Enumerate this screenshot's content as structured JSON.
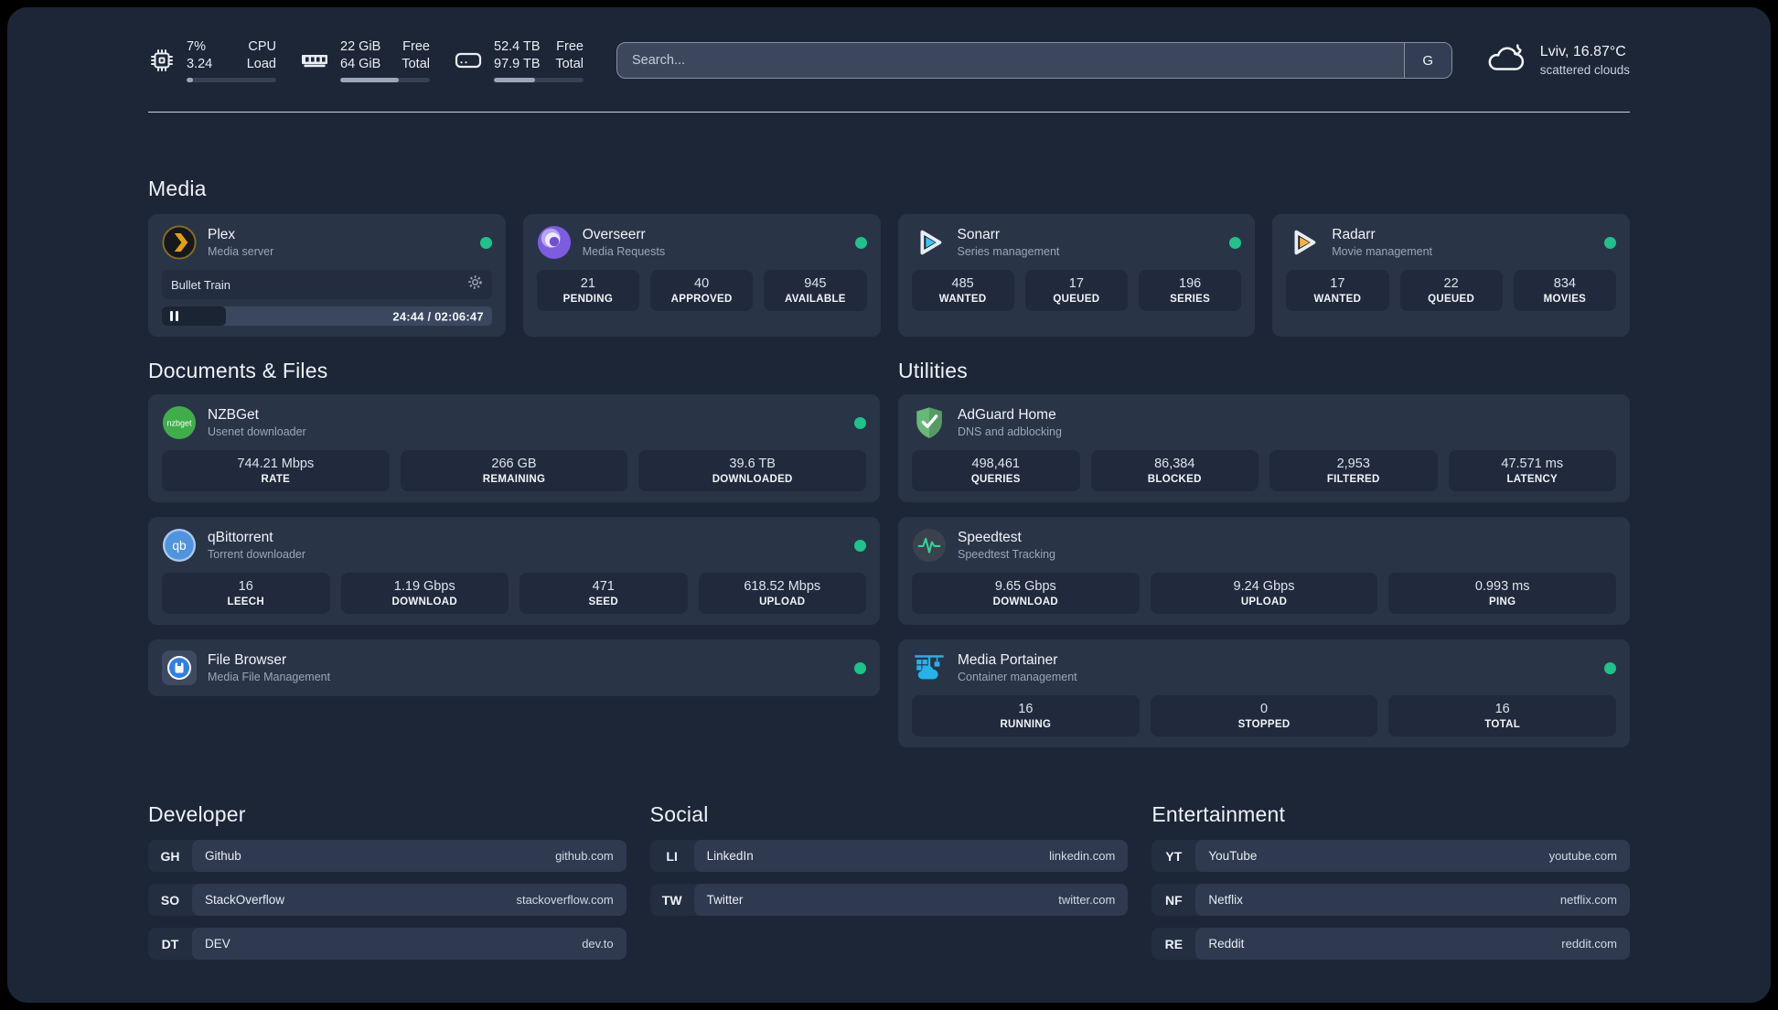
{
  "colors": {
    "status": "#1ec28b",
    "plex": "#e5a00d",
    "overseerr": "#8a6df0",
    "sonarr": "#35c5f4",
    "radarr": "#f7b13c",
    "nzbget": "#3fae4a",
    "qbittorrent": "#4f94dd",
    "filebrowser": "#2f7fe8",
    "adguard": "#67b879",
    "speedtest": "#2fd49c",
    "portainer": "#25b3e8"
  },
  "header": {
    "stats": [
      {
        "id": "cpu",
        "values": [
          "7%",
          "3.24"
        ],
        "labels": [
          "CPU",
          "Load"
        ],
        "progress_pct": 7
      },
      {
        "id": "memory",
        "values": [
          "22 GiB",
          "64 GiB"
        ],
        "labels": [
          "Free",
          "Total"
        ],
        "progress_pct": 65
      },
      {
        "id": "storage",
        "values": [
          "52.4 TB",
          "97.9 TB"
        ],
        "labels": [
          "Free",
          "Total"
        ],
        "progress_pct": 46
      }
    ],
    "search": {
      "placeholder": "Search...",
      "provider_button": "G"
    },
    "weather": {
      "location_temp": "Lviv, 16.87°C",
      "condition": "scattered clouds"
    }
  },
  "media": {
    "title": "Media",
    "plex": {
      "title": "Plex",
      "subtitle": "Media server",
      "now_playing": {
        "title": "Bullet Train",
        "time": "24:44 / 02:06:47",
        "progress_pct": 19.5
      }
    },
    "overseerr": {
      "title": "Overseerr",
      "subtitle": "Media Requests",
      "stats": [
        {
          "value": "21",
          "label": "PENDING"
        },
        {
          "value": "40",
          "label": "APPROVED"
        },
        {
          "value": "945",
          "label": "AVAILABLE"
        }
      ]
    },
    "sonarr": {
      "title": "Sonarr",
      "subtitle": "Series management",
      "stats": [
        {
          "value": "485",
          "label": "WANTED"
        },
        {
          "value": "17",
          "label": "QUEUED"
        },
        {
          "value": "196",
          "label": "SERIES"
        }
      ]
    },
    "radarr": {
      "title": "Radarr",
      "subtitle": "Movie management",
      "stats": [
        {
          "value": "17",
          "label": "WANTED"
        },
        {
          "value": "22",
          "label": "QUEUED"
        },
        {
          "value": "834",
          "label": "MOVIES"
        }
      ]
    }
  },
  "documents": {
    "title": "Documents & Files",
    "nzbget": {
      "title": "NZBGet",
      "subtitle": "Usenet downloader",
      "stats": [
        {
          "value": "744.21 Mbps",
          "label": "RATE"
        },
        {
          "value": "266 GB",
          "label": "REMAINING"
        },
        {
          "value": "39.6 TB",
          "label": "DOWNLOADED"
        }
      ]
    },
    "qbittorrent": {
      "title": "qBittorrent",
      "subtitle": "Torrent downloader",
      "stats": [
        {
          "value": "16",
          "label": "LEECH"
        },
        {
          "value": "1.19 Gbps",
          "label": "DOWNLOAD"
        },
        {
          "value": "471",
          "label": "SEED"
        },
        {
          "value": "618.52 Mbps",
          "label": "UPLOAD"
        }
      ]
    },
    "filebrowser": {
      "title": "File Browser",
      "subtitle": "Media File Management"
    }
  },
  "utilities": {
    "title": "Utilities",
    "adguard": {
      "title": "AdGuard Home",
      "subtitle": "DNS and adblocking",
      "stats": [
        {
          "value": "498,461",
          "label": "QUERIES"
        },
        {
          "value": "86,384",
          "label": "BLOCKED"
        },
        {
          "value": "2,953",
          "label": "FILTERED"
        },
        {
          "value": "47.571 ms",
          "label": "LATENCY"
        }
      ]
    },
    "speedtest": {
      "title": "Speedtest",
      "subtitle": "Speedtest Tracking",
      "stats": [
        {
          "value": "9.65 Gbps",
          "label": "DOWNLOAD"
        },
        {
          "value": "9.24 Gbps",
          "label": "UPLOAD"
        },
        {
          "value": "0.993 ms",
          "label": "PING"
        }
      ]
    },
    "portainer": {
      "title": "Media Portainer",
      "subtitle": "Container management",
      "stats": [
        {
          "value": "16",
          "label": "RUNNING"
        },
        {
          "value": "0",
          "label": "STOPPED"
        },
        {
          "value": "16",
          "label": "TOTAL"
        }
      ]
    }
  },
  "links": {
    "developer": {
      "title": "Developer",
      "items": [
        {
          "abbr": "GH",
          "name": "Github",
          "url": "github.com"
        },
        {
          "abbr": "SO",
          "name": "StackOverflow",
          "url": "stackoverflow.com"
        },
        {
          "abbr": "DT",
          "name": "DEV",
          "url": "dev.to"
        }
      ]
    },
    "social": {
      "title": "Social",
      "items": [
        {
          "abbr": "LI",
          "name": "LinkedIn",
          "url": "linkedin.com"
        },
        {
          "abbr": "TW",
          "name": "Twitter",
          "url": "twitter.com"
        }
      ]
    },
    "entertainment": {
      "title": "Entertainment",
      "items": [
        {
          "abbr": "YT",
          "name": "YouTube",
          "url": "youtube.com"
        },
        {
          "abbr": "NF",
          "name": "Netflix",
          "url": "netflix.com"
        },
        {
          "abbr": "RE",
          "name": "Reddit",
          "url": "reddit.com"
        }
      ]
    }
  }
}
